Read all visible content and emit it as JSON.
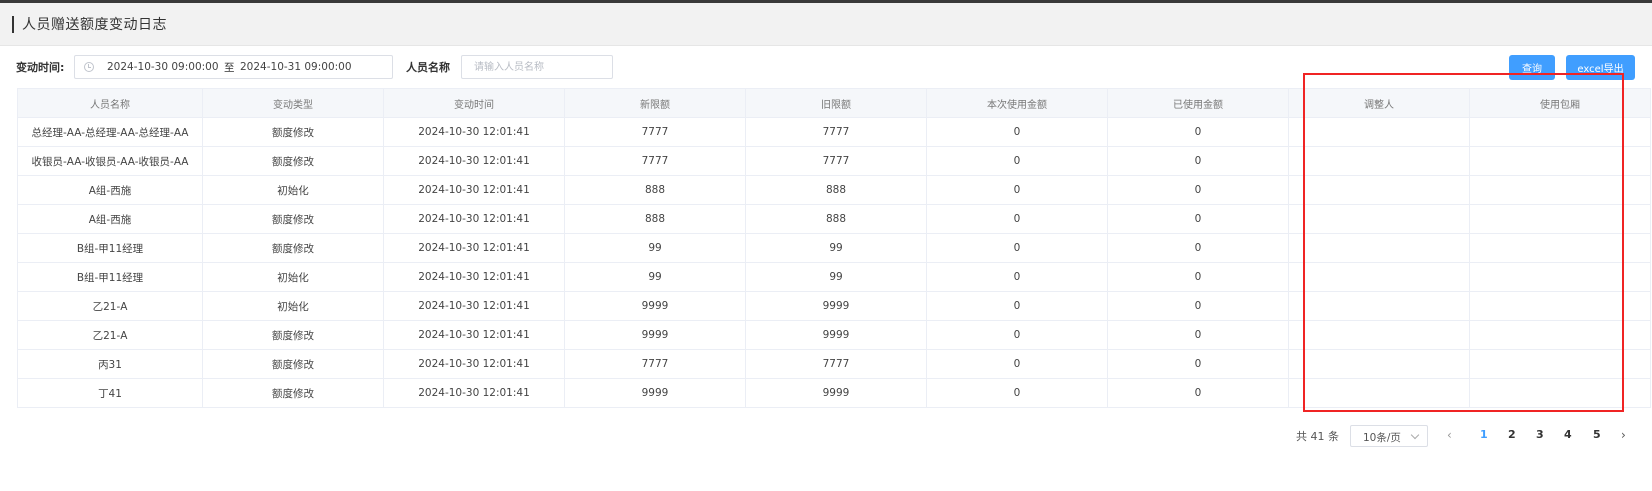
{
  "page": {
    "title": "人员赠送额度变动日志"
  },
  "filters": {
    "time_label": "变动时间:",
    "start_date": "2024-10-30 09:00:00",
    "range_separator": "至",
    "end_date": "2024-10-31 09:00:00",
    "name_label": "人员名称",
    "name_placeholder": "请输入人员名称",
    "name_value": ""
  },
  "buttons": {
    "query": "查询",
    "export": "excel导出"
  },
  "table": {
    "columns": [
      "人员名称",
      "变动类型",
      "变动时间",
      "新限额",
      "旧限额",
      "本次使用金额",
      "已使用金额",
      "调整人",
      "使用包厢"
    ],
    "rows": [
      [
        "总经理-AA-总经理-AA-总经理-AA",
        "额度修改",
        "2024-10-30 12:01:41",
        "7777",
        "7777",
        "0",
        "0",
        "",
        ""
      ],
      [
        "收银员-AA-收银员-AA-收银员-AA",
        "额度修改",
        "2024-10-30 12:01:41",
        "7777",
        "7777",
        "0",
        "0",
        "",
        ""
      ],
      [
        "A组-西施",
        "初始化",
        "2024-10-30 12:01:41",
        "888",
        "888",
        "0",
        "0",
        "",
        ""
      ],
      [
        "A组-西施",
        "额度修改",
        "2024-10-30 12:01:41",
        "888",
        "888",
        "0",
        "0",
        "",
        ""
      ],
      [
        "B组-甲11经理",
        "额度修改",
        "2024-10-30 12:01:41",
        "99",
        "99",
        "0",
        "0",
        "",
        ""
      ],
      [
        "B组-甲11经理",
        "初始化",
        "2024-10-30 12:01:41",
        "99",
        "99",
        "0",
        "0",
        "",
        ""
      ],
      [
        "乙21-A",
        "初始化",
        "2024-10-30 12:01:41",
        "9999",
        "9999",
        "0",
        "0",
        "",
        ""
      ],
      [
        "乙21-A",
        "额度修改",
        "2024-10-30 12:01:41",
        "9999",
        "9999",
        "0",
        "0",
        "",
        ""
      ],
      [
        "丙31",
        "额度修改",
        "2024-10-30 12:01:41",
        "7777",
        "7777",
        "0",
        "0",
        "",
        ""
      ],
      [
        "丁41",
        "额度修改",
        "2024-10-30 12:01:41",
        "9999",
        "9999",
        "0",
        "0",
        "",
        ""
      ]
    ]
  },
  "pagination": {
    "total_text": "共 41 条",
    "page_size": "10条/页",
    "pages": [
      "1",
      "2",
      "3",
      "4",
      "5"
    ],
    "current_page": "1",
    "prev": "‹",
    "next": "›"
  },
  "colors": {
    "primary": "#409eff",
    "highlight": "#f02424"
  },
  "icons": {
    "date_picker": "clock-icon",
    "page_size_dropdown": "chevron-down-icon"
  }
}
